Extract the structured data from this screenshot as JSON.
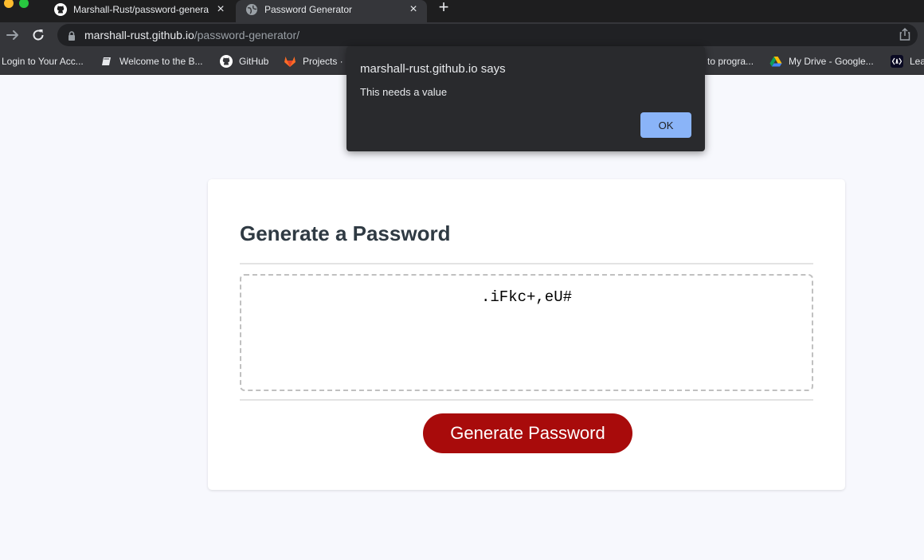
{
  "browser": {
    "tabs": [
      {
        "title": "Marshall-Rust/password-generator",
        "favicon": "github-icon",
        "active": false
      },
      {
        "title": "Password Generator",
        "favicon": "globe-icon",
        "active": true
      }
    ],
    "new_tab_label": "+",
    "close_label": "×",
    "url_host": "marshall-rust.github.io",
    "url_path": "/password-generator/",
    "bookmarks": [
      {
        "label": "Login to Your Acc...",
        "icon": "none"
      },
      {
        "label": "Welcome to the B...",
        "icon": "book-icon"
      },
      {
        "label": "GitHub",
        "icon": "github-icon"
      },
      {
        "label": "Projects ·",
        "icon": "gitlab-icon"
      },
      {
        "label": "to progra...",
        "icon": "none"
      },
      {
        "label": "My Drive - Google...",
        "icon": "drive-icon"
      },
      {
        "label": "Lea",
        "icon": "code-icon"
      }
    ]
  },
  "dialog": {
    "title": "marshall-rust.github.io says",
    "message": "This needs a value",
    "ok_label": "OK"
  },
  "card": {
    "title": "Generate a Password",
    "password": ".iFkc+,eU#",
    "button_label": "Generate Password"
  },
  "colors": {
    "button": "#a80b0b",
    "title": "#2f3a43",
    "page_bg": "#f7f8fd",
    "dialog_bg": "#292a2d",
    "ok_button": "#8ab4f8"
  }
}
